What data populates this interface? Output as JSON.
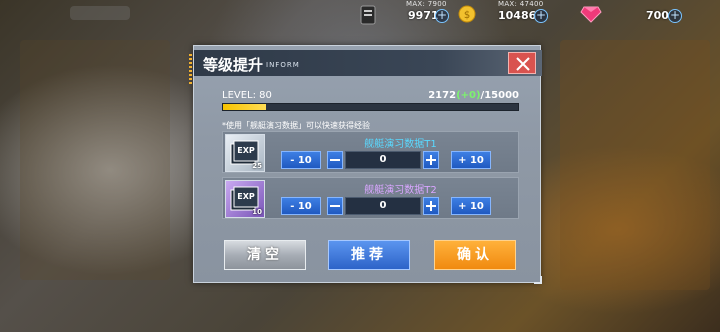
{
  "resources": [
    {
      "max": "MAX: 7900",
      "value": "9971",
      "icon": "document-icon"
    },
    {
      "max": "MAX: 47400",
      "value": "10486",
      "icon": "gold-coin-icon"
    },
    {
      "max": "",
      "value": "700",
      "icon": "gem-icon"
    }
  ],
  "dialog": {
    "title": "等级提升",
    "subtitle": "INFORM",
    "level_label": "LEVEL: 80",
    "exp_current": "2172",
    "exp_gain": "(+0)",
    "exp_max": "/15000",
    "exp_progress": 0.145,
    "hint": "*使用「舰艇演习数据」可以快速获得经验",
    "items": [
      {
        "name": "舰艇演习数据T1",
        "count": "25",
        "quantity": "0",
        "minus10": "- 10",
        "plus10": "+ 10"
      },
      {
        "name": "舰艇演习数据T2",
        "count": "10",
        "quantity": "0",
        "minus10": "- 10",
        "plus10": "+ 10"
      }
    ],
    "buttons": {
      "clear": "清空",
      "recommend": "推荐",
      "confirm": "确认"
    }
  },
  "colors": {
    "accent_blue": "#2d63c8",
    "confirm_orange": "#f08a10",
    "close_red": "#d9534f",
    "exp_yellow": "#f7c300",
    "gain_green": "#7cf36d"
  }
}
